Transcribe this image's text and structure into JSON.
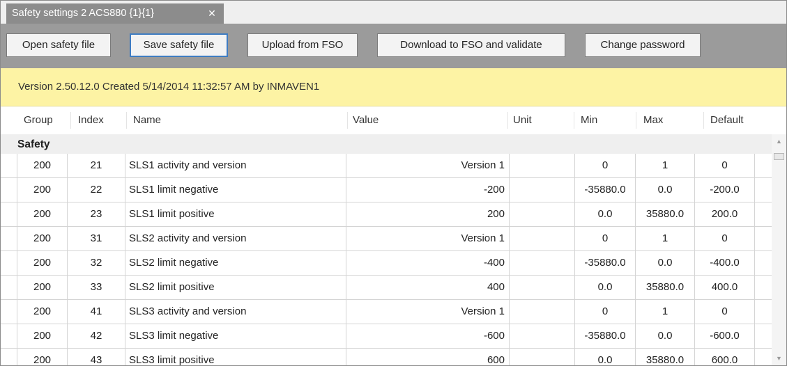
{
  "tab": {
    "title": "Safety settings 2 ACS880 {1}{1}",
    "close_glyph": "✕"
  },
  "toolbar": {
    "open_label": "Open safety file",
    "save_label": "Save safety file",
    "upload_label": "Upload from FSO",
    "download_label": "Download to FSO and validate",
    "password_label": "Change password"
  },
  "banner": {
    "text": "Version 2.50.12.0 Created 5/14/2014 11:32:57 AM by INMAVEN1"
  },
  "table": {
    "headers": {
      "group": "Group",
      "index": "Index",
      "name": "Name",
      "value": "Value",
      "unit": "Unit",
      "min": "Min",
      "max": "Max",
      "default": "Default"
    },
    "section": "Safety",
    "rows": [
      {
        "group": "200",
        "index": "21",
        "name": "SLS1 activity and version",
        "value": "Version 1",
        "unit": "",
        "min": "0",
        "max": "1",
        "default": "0"
      },
      {
        "group": "200",
        "index": "22",
        "name": "SLS1 limit negative",
        "value": "-200",
        "unit": "",
        "min": "-35880.0",
        "max": "0.0",
        "default": "-200.0"
      },
      {
        "group": "200",
        "index": "23",
        "name": "SLS1 limit positive",
        "value": "200",
        "unit": "",
        "min": "0.0",
        "max": "35880.0",
        "default": "200.0"
      },
      {
        "group": "200",
        "index": "31",
        "name": "SLS2 activity and version",
        "value": "Version 1",
        "unit": "",
        "min": "0",
        "max": "1",
        "default": "0"
      },
      {
        "group": "200",
        "index": "32",
        "name": "SLS2 limit negative",
        "value": "-400",
        "unit": "",
        "min": "-35880.0",
        "max": "0.0",
        "default": "-400.0"
      },
      {
        "group": "200",
        "index": "33",
        "name": "SLS2 limit positive",
        "value": "400",
        "unit": "",
        "min": "0.0",
        "max": "35880.0",
        "default": "400.0"
      },
      {
        "group": "200",
        "index": "41",
        "name": "SLS3 activity and version",
        "value": "Version 1",
        "unit": "",
        "min": "0",
        "max": "1",
        "default": "0"
      },
      {
        "group": "200",
        "index": "42",
        "name": "SLS3 limit negative",
        "value": "-600",
        "unit": "",
        "min": "-35880.0",
        "max": "0.0",
        "default": "-600.0"
      },
      {
        "group": "200",
        "index": "43",
        "name": "SLS3 limit positive",
        "value": "600",
        "unit": "",
        "min": "0.0",
        "max": "35880.0",
        "default": "600.0"
      }
    ]
  },
  "scrollbar": {
    "up_glyph": "▲",
    "down_glyph": "▼"
  }
}
